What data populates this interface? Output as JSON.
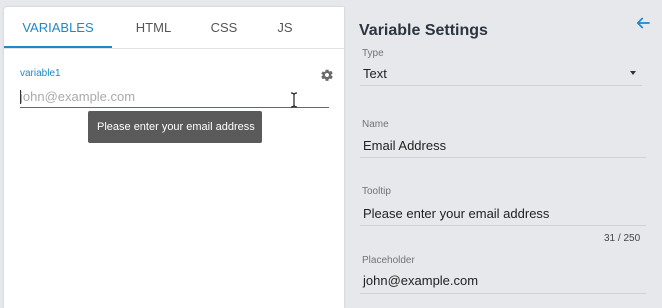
{
  "tabs": [
    {
      "label": "VARIABLES",
      "active": true
    },
    {
      "label": "HTML",
      "active": false
    },
    {
      "label": "CSS",
      "active": false
    },
    {
      "label": "JS",
      "active": false
    }
  ],
  "editor": {
    "variable_label": "variable1",
    "input_placeholder": "john@example.com",
    "input_value": "",
    "tooltip": "Please enter your email address"
  },
  "settings": {
    "title": "Variable Settings",
    "type_label": "Type",
    "type_value": "Text",
    "name_label": "Name",
    "name_value": "Email Address",
    "tooltip_label": "Tooltip",
    "tooltip_value": "Please enter your email address",
    "tooltip_counter": "31 / 250",
    "placeholder_label": "Placeholder",
    "placeholder_value": "john@example.com"
  },
  "icons": {
    "gear": "gear-icon",
    "back": "arrow-left-icon",
    "dropdown": "chevron-down-icon"
  },
  "colors": {
    "accent": "#1e88c8",
    "input_underline": "#1a8a80",
    "tooltip_bg": "#5a5a5a",
    "right_panel_bg": "#e6e8eb"
  }
}
